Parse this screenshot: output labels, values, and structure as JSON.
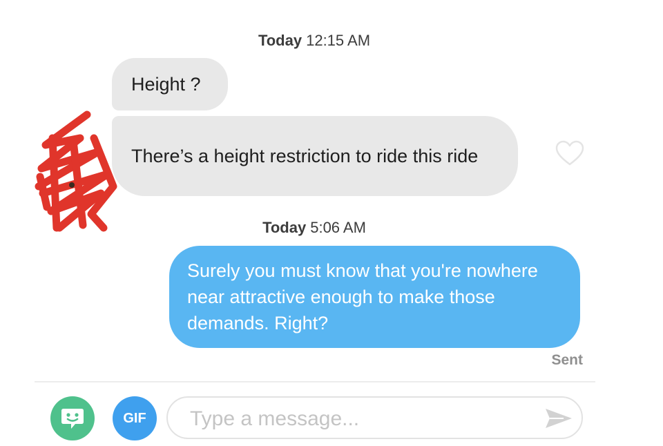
{
  "conversation": {
    "groups": [
      {
        "timestamp_day": "Today",
        "timestamp_time": "12:15 AM",
        "messages": [
          {
            "text": "Height ?",
            "direction": "incoming"
          },
          {
            "text": "There’s a height restriction to ride this ride",
            "direction": "incoming"
          }
        ]
      },
      {
        "timestamp_day": "Today",
        "timestamp_time": "5:06 AM",
        "messages": [
          {
            "text": "Surely you must know that you're nowhere near attractive enough to make those demands. Right?",
            "direction": "outgoing"
          }
        ]
      }
    ],
    "sent_status": "Sent"
  },
  "composer": {
    "gif_label": "GIF",
    "placeholder": "Type a message...",
    "value": ""
  },
  "icons": {
    "like": "heart-outline-icon",
    "sticker": "sticker-face-icon",
    "send": "send-arrow-icon"
  },
  "colors": {
    "incoming_bubble": "#e8e8e8",
    "outgoing_bubble": "#59b6f2",
    "sticker_button": "#4fc18c",
    "gif_button": "#3fa0ee",
    "redaction_scribble": "#e0352b"
  }
}
